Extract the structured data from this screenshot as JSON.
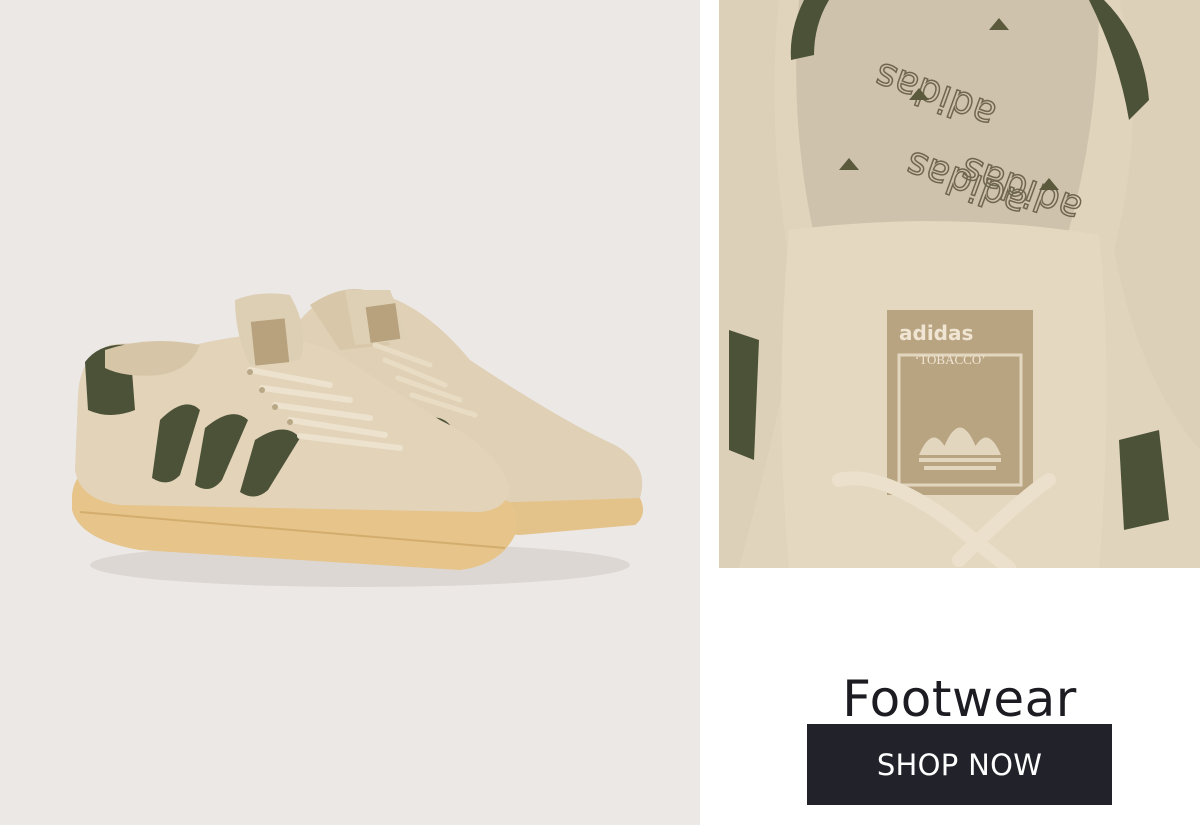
{
  "promo": {
    "title": "Footwear",
    "cta_label": "SHOP NOW"
  },
  "closeup": {
    "tongue_logo_text": "adidas",
    "tongue_model_text": "‘TOBACCO’",
    "insole_pattern_text": "adidas"
  },
  "colors": {
    "left_background": "#ece8e6",
    "suede": "#e2d3b9",
    "stripes": "#4c5238",
    "sole": "#e6c48a",
    "button_bg": "#22222b",
    "title_text": "#1c1c22"
  },
  "images": [
    {
      "name": "sneaker-pair-photo",
      "subject": "pair of beige suede sneakers with olive green three stripes on a gum sole"
    },
    {
      "name": "sneaker-closeup-photo",
      "subject": "close-up of sneaker tongue label and patterned insole"
    }
  ]
}
